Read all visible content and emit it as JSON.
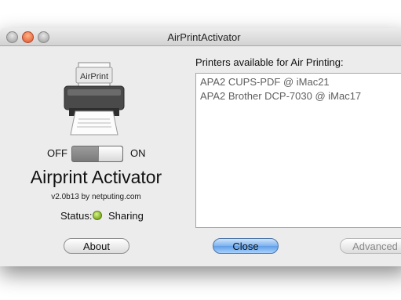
{
  "window": {
    "title": "AirPrintActivator"
  },
  "app": {
    "printer_label": "AirPrint",
    "toggle_off": "OFF",
    "toggle_on": "ON",
    "name": "Airprint Activator",
    "version": "v2.0b13 by netputing.com",
    "status_label": "Status:",
    "status_value": "Sharing",
    "status_color": "#7fae1f"
  },
  "printers": {
    "label": "Printers available for Air Printing:",
    "items": [
      "APA2 CUPS-PDF @ iMac21",
      "APA2 Brother DCP-7030 @ iMac17"
    ]
  },
  "buttons": {
    "about": "About",
    "close": "Close",
    "advanced": "Advanced"
  },
  "colors": {
    "window_bg": "#ececec",
    "default_button": "#6fa8ee"
  }
}
